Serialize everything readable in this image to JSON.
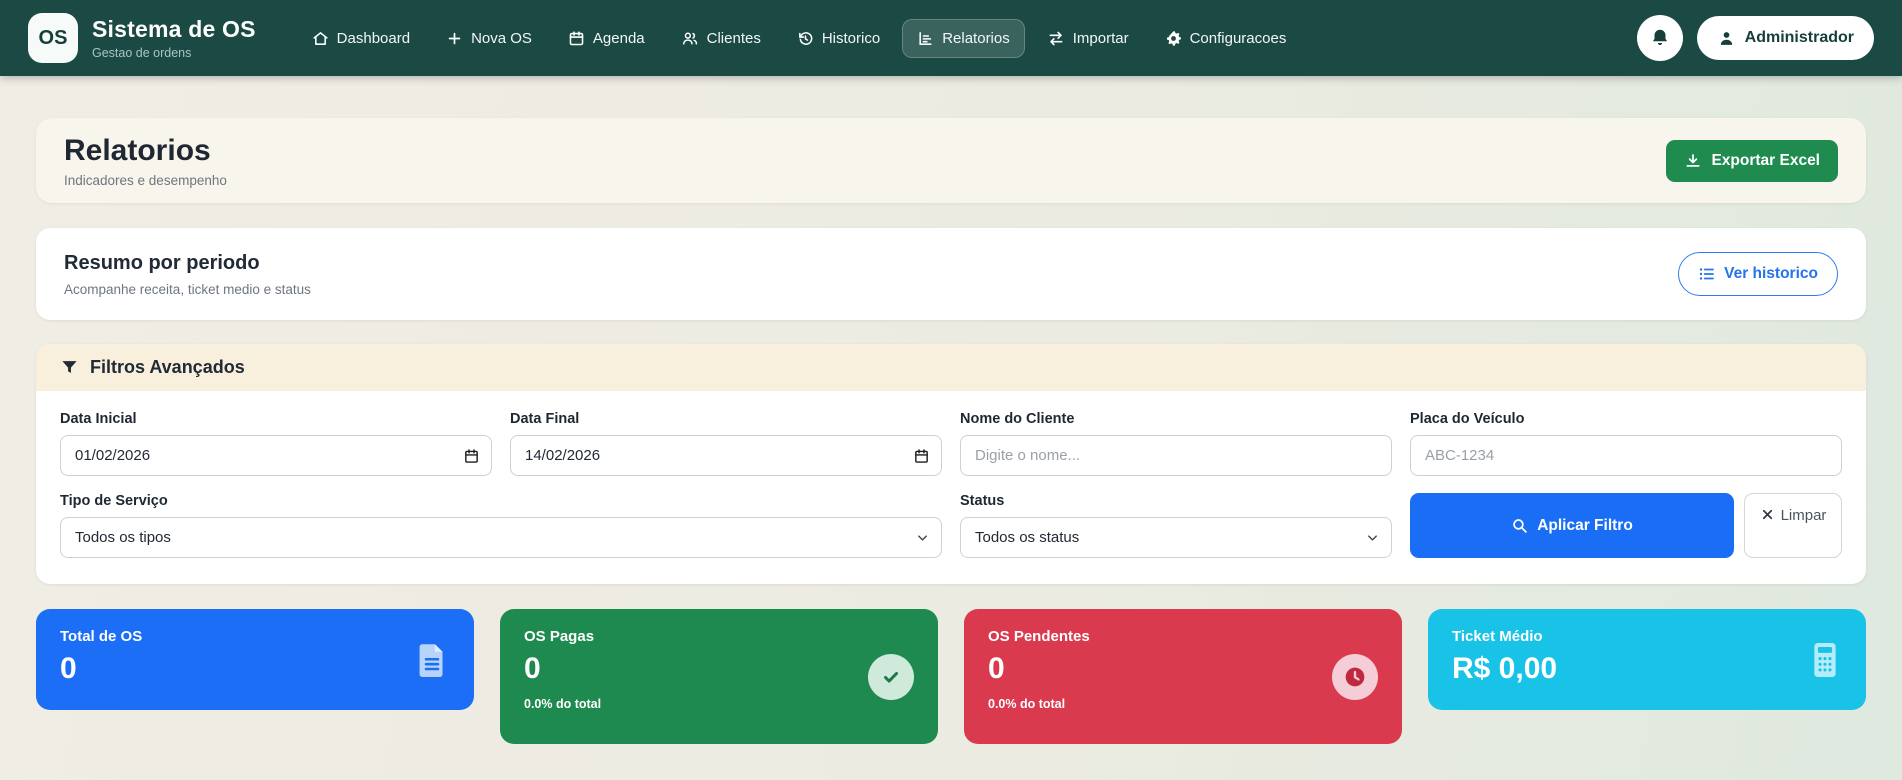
{
  "brand": {
    "logo": "OS",
    "title": "Sistema de OS",
    "subtitle": "Gestao de ordens"
  },
  "nav": {
    "items": [
      {
        "label": "Dashboard",
        "icon": "home-icon",
        "active": false
      },
      {
        "label": "Nova OS",
        "icon": "plus-icon",
        "active": false
      },
      {
        "label": "Agenda",
        "icon": "calendar-icon",
        "active": false
      },
      {
        "label": "Clientes",
        "icon": "users-icon",
        "active": false
      },
      {
        "label": "Historico",
        "icon": "history-icon",
        "active": false
      },
      {
        "label": "Relatorios",
        "icon": "chart-icon",
        "active": true
      },
      {
        "label": "Importar",
        "icon": "transfer-icon",
        "active": false
      },
      {
        "label": "Configuracoes",
        "icon": "gear-icon",
        "active": false
      }
    ]
  },
  "user": {
    "name": "Administrador",
    "icon": "person-icon",
    "notification_icon": "bell-icon"
  },
  "page": {
    "title": "Relatorios",
    "subtitle": "Indicadores e desempenho",
    "export_label": "Exportar Excel",
    "export_icon": "download-icon"
  },
  "summary": {
    "title": "Resumo por periodo",
    "subtitle": "Acompanhe receita, ticket medio e status",
    "history_label": "Ver historico",
    "history_icon": "list-icon"
  },
  "filters": {
    "title": "Filtros Avançados",
    "title_icon": "funnel-icon",
    "data_inicial": {
      "label": "Data Inicial",
      "value": "01/02/2026",
      "icon": "calendar-icon"
    },
    "data_final": {
      "label": "Data Final",
      "value": "14/02/2026",
      "icon": "calendar-icon"
    },
    "nome_cliente": {
      "label": "Nome do Cliente",
      "placeholder": "Digite o nome..."
    },
    "placa": {
      "label": "Placa do Veículo",
      "placeholder": "ABC-1234"
    },
    "tipo_servico": {
      "label": "Tipo de Serviço",
      "value": "Todos os tipos"
    },
    "status": {
      "label": "Status",
      "value": "Todos os status"
    },
    "apply_label": "Aplicar Filtro",
    "apply_icon": "search-icon",
    "clear_label": "Limpar",
    "clear_icon": "x-icon"
  },
  "stats": {
    "cards": [
      {
        "title": "Total de OS",
        "value": "0",
        "subtitle": "",
        "color": "#1b6ef5",
        "icon": "document-icon"
      },
      {
        "title": "OS Pagas",
        "value": "0",
        "subtitle": "0.0% do total",
        "color": "#1e8a4f",
        "icon": "check-circle-icon"
      },
      {
        "title": "OS Pendentes",
        "value": "0",
        "subtitle": "0.0% do total",
        "color": "#da3a4e",
        "icon": "clock-icon"
      },
      {
        "title": "Ticket Médio",
        "value": "R$ 0,00",
        "subtitle": "",
        "color": "#19c3e8",
        "icon": "calculator-icon"
      }
    ]
  },
  "colors": {
    "header_bg": "#1b4a44",
    "page_bg": "#ecebe1",
    "accent_blue": "#1a6ef5",
    "accent_green": "#1f8b4e",
    "filters_head_bg": "#f9efdd",
    "link_blue": "#2373ee"
  }
}
